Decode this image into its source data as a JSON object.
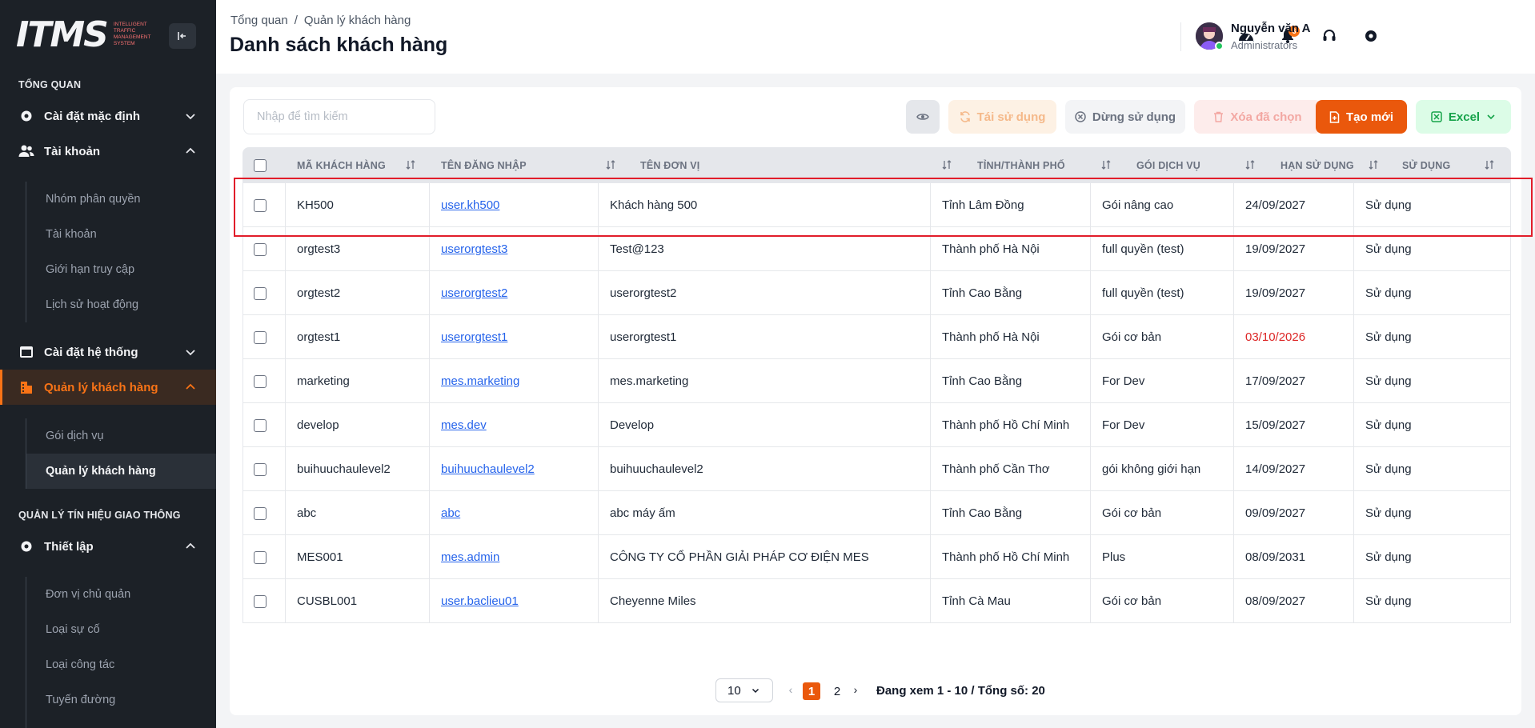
{
  "brand": {
    "logo_text": "ITMS",
    "logo_subtitle": "Intelligent Traffic Management System"
  },
  "sidebar": {
    "section_overview": "TỔNG QUAN",
    "default_settings": "Cài đặt mặc định",
    "account": "Tài khoản",
    "account_items": [
      "Nhóm phân quyền",
      "Tài khoản",
      "Giới hạn truy cập",
      "Lịch sử hoạt động"
    ],
    "system_settings": "Cài đặt hệ thống",
    "customer_mgmt": "Quản lý khách hàng",
    "customer_items": [
      "Gói dịch vụ",
      "Quản lý khách hàng"
    ],
    "section_traffic": "QUẢN LÝ TÍN HIỆU GIAO THÔNG",
    "setup": "Thiết lập",
    "setup_items": [
      "Đơn vị chủ quản",
      "Loại sự cố",
      "Loại công tác",
      "Tuyến đường"
    ]
  },
  "header": {
    "breadcrumb": [
      "Tổng quan",
      "/",
      "Quản lý khách hàng"
    ],
    "title": "Danh sách khách hàng",
    "notification_count": "6",
    "user_name": "Nguyễn văn A",
    "user_role": "Administrators"
  },
  "toolbar": {
    "search_placeholder": "Nhập để tìm kiếm",
    "reuse_label": "Tái sử dụng",
    "stop_label": "Dừng sử dụng",
    "delete_label": "Xóa đã chọn",
    "new_label": "Tạo mới",
    "excel_label": "Excel"
  },
  "table": {
    "columns": [
      "MÃ KHÁCH HÀNG",
      "TÊN ĐĂNG NHẬP",
      "TÊN ĐƠN VỊ",
      "TỈNH/THÀNH PHỐ",
      "GÓI DỊCH VỤ",
      "HẠN SỬ DỤNG",
      "SỬ DỤNG"
    ],
    "rows": [
      {
        "code": "KH500",
        "username": "user.kh500",
        "unit": "Khách hàng 500",
        "province": "Tỉnh Lâm Đồng",
        "package": "Gói nâng cao",
        "expiry": "24/09/2027",
        "status": "Sử dụng"
      },
      {
        "code": "orgtest3",
        "username": "userorgtest3",
        "unit": "Test@123",
        "province": "Thành phố Hà Nội",
        "package": "full quyền (test)",
        "expiry": "19/09/2027",
        "status": "Sử dụng"
      },
      {
        "code": "orgtest2",
        "username": "userorgtest2",
        "unit": "userorgtest2",
        "province": "Tỉnh Cao Bằng",
        "package": "full quyền (test)",
        "expiry": "19/09/2027",
        "status": "Sử dụng"
      },
      {
        "code": "orgtest1",
        "username": "userorgtest1",
        "unit": "userorgtest1",
        "province": "Thành phố Hà Nội",
        "package": "Gói cơ bản",
        "expiry": "03/10/2026",
        "status": "Sử dụng"
      },
      {
        "code": "marketing",
        "username": "mes.marketing",
        "unit": "mes.marketing",
        "province": "Tỉnh Cao Bằng",
        "package": "For Dev",
        "expiry": "17/09/2027",
        "status": "Sử dụng"
      },
      {
        "code": "develop",
        "username": "mes.dev",
        "unit": "Develop",
        "province": "Thành phố Hồ Chí Minh",
        "package": "For Dev",
        "expiry": "15/09/2027",
        "status": "Sử dụng"
      },
      {
        "code": "buihuuchaulevel2",
        "username": "buihuuchaulevel2",
        "unit": "buihuuchaulevel2",
        "province": "Thành phố Cần Thơ",
        "package": "gói không giới hạn",
        "expiry": "14/09/2027",
        "status": "Sử dụng"
      },
      {
        "code": "abc",
        "username": "abc",
        "unit": "abc máy ấm",
        "province": "Tỉnh Cao Bằng",
        "package": "Gói cơ bản",
        "expiry": "09/09/2027",
        "status": "Sử dụng"
      },
      {
        "code": "MES001",
        "username": "mes.admin",
        "unit": "CÔNG TY CỔ PHẦN GIẢI PHÁP CƠ ĐIỆN MES",
        "province": "Thành phố Hồ Chí Minh",
        "package": "Plus",
        "expiry": "08/09/2031",
        "status": "Sử dụng"
      },
      {
        "code": "CUSBL001",
        "username": "user.baclieu01",
        "unit": "Cheyenne Miles",
        "province": "Tỉnh Cà Mau",
        "package": "Gói cơ bản",
        "expiry": "08/09/2027",
        "status": "Sử dụng"
      }
    ]
  },
  "pagination": {
    "page_size": "10",
    "pages": [
      "1",
      "2"
    ],
    "current_page": "1",
    "info": "Đang xem 1 - 10 / Tổng số: 20"
  },
  "colors": {
    "accent": "#ea580c",
    "sidebar_bg": "#1c2127",
    "link": "#2563eb",
    "expired": "#dc2626",
    "highlight_box": "#e11d2a"
  }
}
